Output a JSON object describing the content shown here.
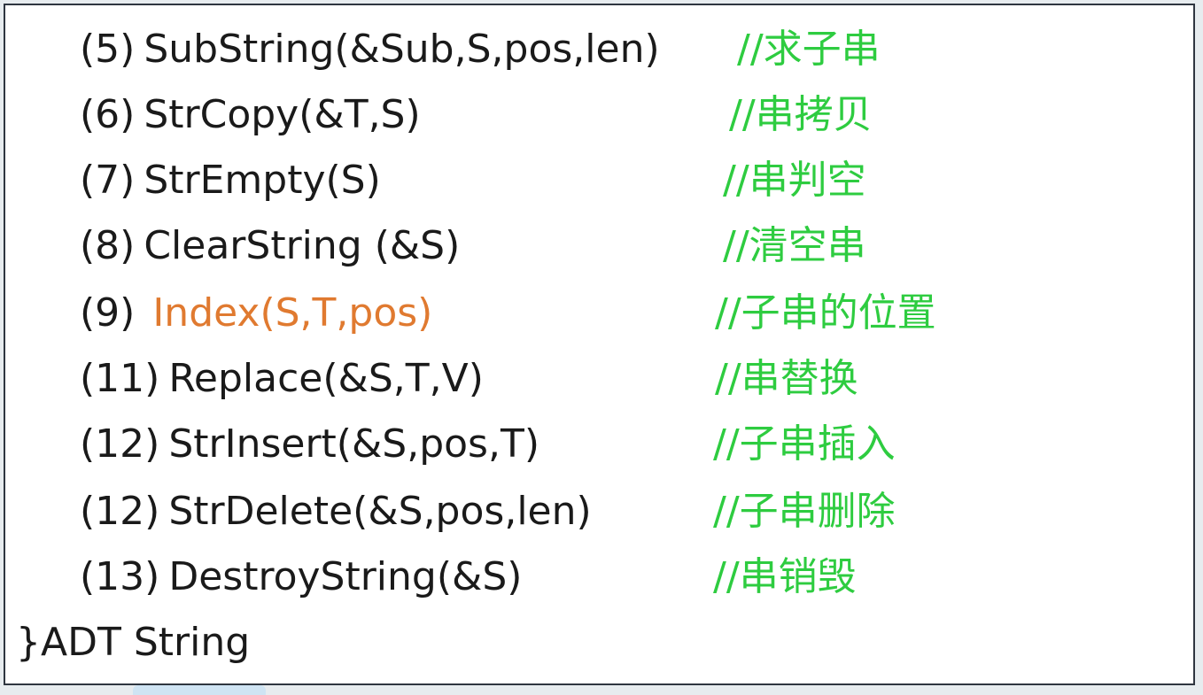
{
  "lines": [
    {
      "num": "(5)",
      "code": "SubString(&Sub,S,pos,len)",
      "comment": "//求子串"
    },
    {
      "num": "(6)",
      "code": "StrCopy(&T,S)",
      "comment": "//串拷贝"
    },
    {
      "num": "(7)",
      "code": "StrEmpty(S)",
      "comment": "//串判空"
    },
    {
      "num": "(8)",
      "code": "ClearString (&S)",
      "comment": "//清空串"
    },
    {
      "num": "(9)",
      "code": "Index(S,T,pos)",
      "comment": "//子串的位置"
    },
    {
      "num": "(11)",
      "code": "Replace(&S,T,V)",
      "comment": "//串替换"
    },
    {
      "num": "(12)",
      "code": "StrInsert(&S,pos,T)",
      "comment": "//子串插入"
    },
    {
      "num": "(12)",
      "code": "StrDelete(&S,pos,len)",
      "comment": "//子串删除"
    },
    {
      "num": "(13)",
      "code": "DestroyString(&S)",
      "comment": "//串销毁"
    }
  ],
  "footer": "}ADT String",
  "colors": {
    "code": "#1a1a1a",
    "comment": "#2ecc40",
    "highlight": "#e07a30",
    "border": "#2f3640"
  }
}
